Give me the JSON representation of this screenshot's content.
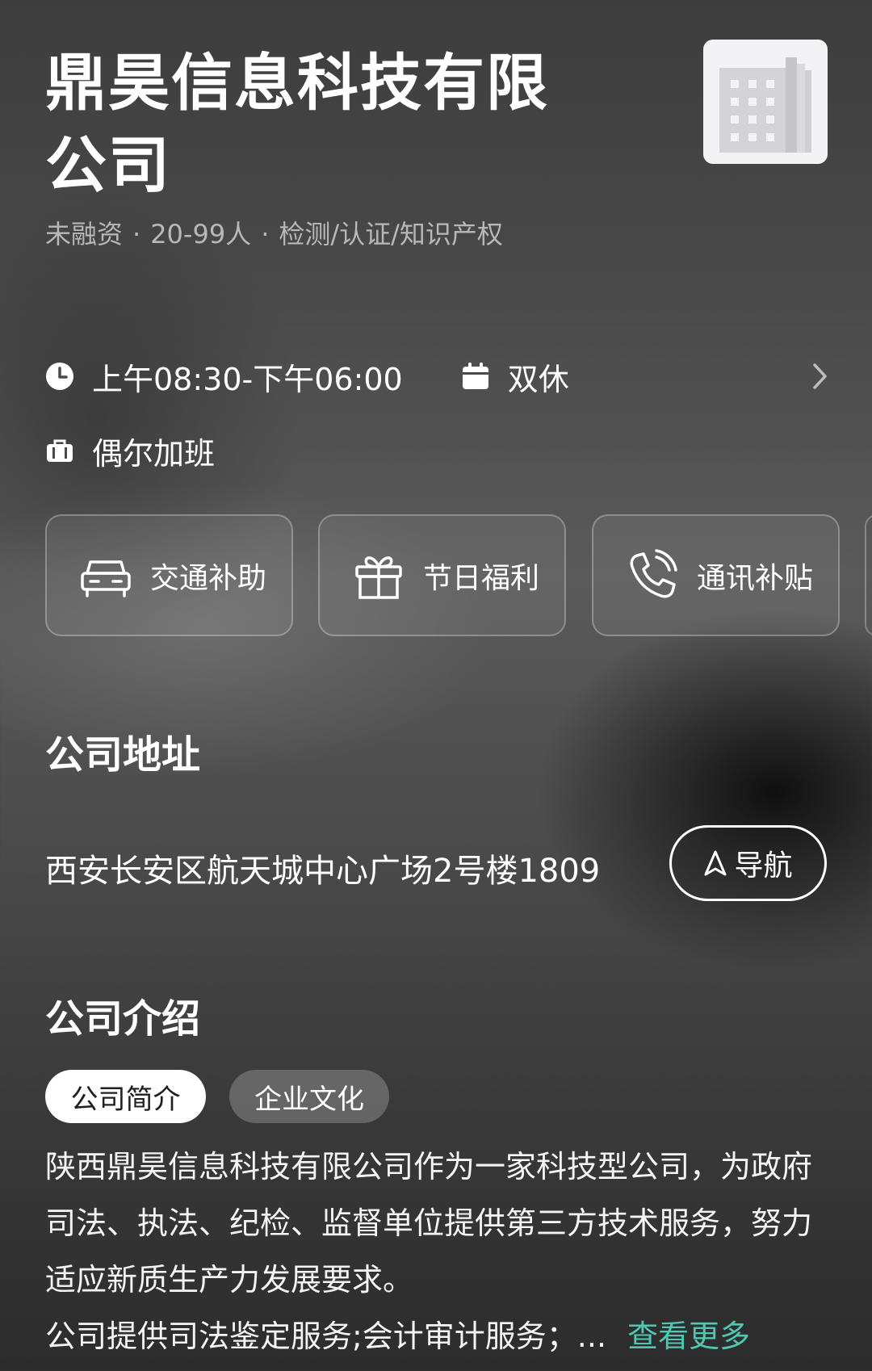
{
  "company": {
    "name": "鼎昊信息科技有限公司",
    "financing": "未融资",
    "size": "20-99人",
    "industry": "检测/认证/知识产权",
    "separator": "·",
    "logo_icon": "building-icon"
  },
  "work_info": {
    "hours": "上午08:30-下午06:00",
    "rest": "双休",
    "overtime": "偶尔加班",
    "icons": [
      "clock-icon",
      "calendar-icon",
      "briefcase-icon",
      "chevron-right-icon"
    ]
  },
  "benefits": [
    {
      "label": "交通补助",
      "icon": "car-icon"
    },
    {
      "label": "节日福利",
      "icon": "gift-icon"
    },
    {
      "label": "通讯补贴",
      "icon": "phone-icon"
    }
  ],
  "address_section": {
    "title": "公司地址",
    "address": "西安长安区航天城中心广场2号楼1809",
    "nav_label": "导航",
    "nav_icon": "navigation-arrow-icon"
  },
  "intro_section": {
    "title": "公司介绍",
    "tabs": [
      {
        "label": "公司简介",
        "active": true
      },
      {
        "label": "企业文化",
        "active": false
      }
    ],
    "text": "陕西鼎昊信息科技有限公司作为一家科技型公司，为政府司法、执法、纪检、监督单位提供第三方技术服务，努力适应新质生产力发展要求。",
    "text_more": "公司提供司法鉴定服务;会计审计服务；...",
    "see_more": "查看更多"
  },
  "colors": {
    "accent": "#4fc7b2",
    "active_tab_bg": "#ffffff"
  }
}
